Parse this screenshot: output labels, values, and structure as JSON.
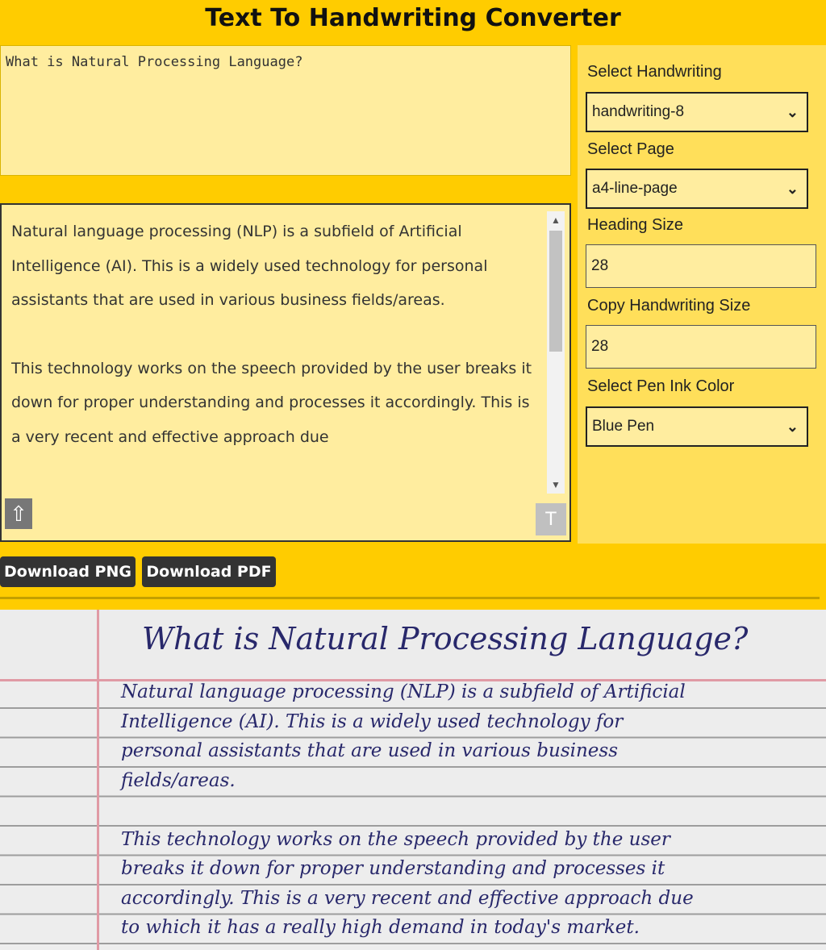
{
  "app": {
    "title": "Text To Handwriting Converter"
  },
  "editor": {
    "heading_text": "What is Natural Processing Language?",
    "body_paragraphs": [
      "Natural language processing (NLP) is a subfield of Artificial Intelligence (AI). This is a widely used technology for personal assistants that are used in various business fields/areas.",
      "This technology works on the speech provided by the user breaks it down for proper understanding and processes it accordingly. This is a very recent and effective approach due"
    ]
  },
  "controls": {
    "handwriting_label": "Select Handwriting",
    "handwriting_value": "handwriting-8",
    "page_label": "Select Page",
    "page_value": "a4-line-page",
    "heading_size_label": "Heading Size",
    "heading_size_value": "28",
    "copy_size_label": "Copy Handwriting Size",
    "copy_size_value": "28",
    "ink_label": "Select Pen Ink Color",
    "ink_value": "Blue Pen"
  },
  "buttons": {
    "png": "Download PNG",
    "pdf": "Download PDF"
  },
  "preview": {
    "heading": "What is Natural Processing Language?",
    "lines_para1": [
      "Natural language processing (NLP) is a subfield of Artificial",
      "Intelligence (AI). This is a widely used technology for",
      "personal assistants that are used in various business",
      "fields/areas."
    ],
    "lines_para2": [
      "This technology works on the speech provided by the user",
      "breaks it down for proper understanding and processes it",
      "accordingly. This is a very recent and effective approach due",
      "to which it has a really high demand in today's market."
    ]
  },
  "icons": {
    "upload": "upload-icon",
    "format": "clear-format-icon",
    "chevron": "chevron-down-icon"
  },
  "colors": {
    "background": "#ffcc00",
    "panel": "#ffdf5a",
    "input": "#ffed9f",
    "ink": "#28286b",
    "margin_line": "#e09aa5"
  }
}
